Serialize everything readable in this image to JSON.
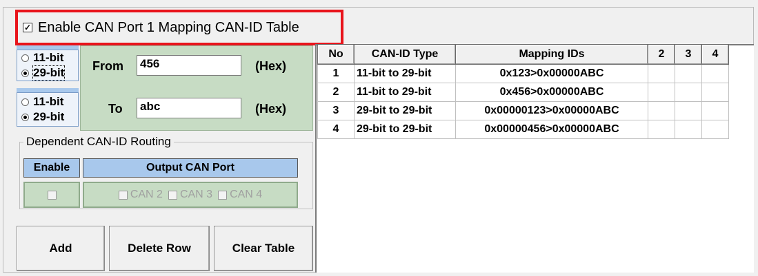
{
  "enable": {
    "checked_mark": "☑",
    "label": "Enable CAN Port 1 Mapping CAN-ID Table"
  },
  "id_mode_from": {
    "opt1": "11-bit",
    "opt2": "29-bit",
    "selected": "29-bit"
  },
  "id_mode_to": {
    "opt1": "11-bit",
    "opt2": "29-bit",
    "selected": "29-bit"
  },
  "from": {
    "label": "From",
    "value": "456",
    "unit": "(Hex)"
  },
  "to": {
    "label": "To",
    "value": "abc",
    "unit": "(Hex)"
  },
  "dependent": {
    "title": "Dependent CAN-ID Routing",
    "enable_header": "Enable",
    "output_header": "Output CAN Port",
    "can2": "CAN 2",
    "can3": "CAN 3",
    "can4": "CAN 4"
  },
  "buttons": {
    "add": "Add",
    "delete_row": "Delete Row",
    "clear_table": "Clear Table"
  },
  "table": {
    "headers": [
      "No",
      "CAN-ID Type",
      "Mapping IDs",
      "2",
      "3",
      "4"
    ],
    "rows": [
      {
        "no": "1",
        "type": "11-bit to 29-bit",
        "map": "0x123>0x00000ABC"
      },
      {
        "no": "2",
        "type": "11-bit to 29-bit",
        "map": "0x456>0x00000ABC"
      },
      {
        "no": "3",
        "type": "29-bit to 29-bit",
        "map": "0x00000123>0x00000ABC"
      },
      {
        "no": "4",
        "type": "29-bit to 29-bit",
        "map": "0x00000456>0x00000ABC"
      }
    ]
  },
  "colors": {
    "highlight": "#e8141b",
    "blue_header": "#a8c8ec",
    "green_panel": "#c7dcc4"
  }
}
